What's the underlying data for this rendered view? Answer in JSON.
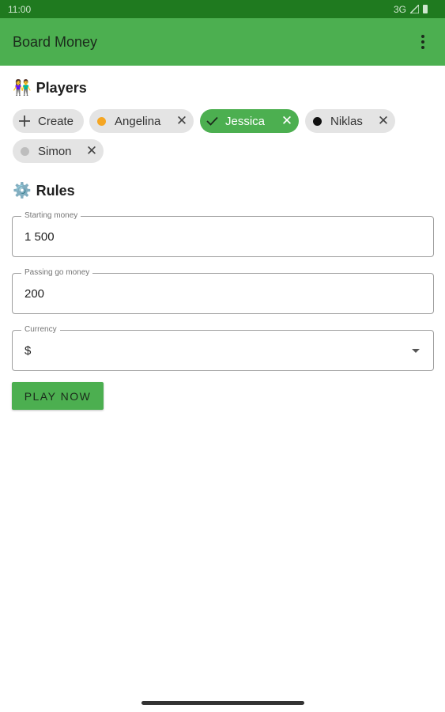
{
  "status_bar": {
    "time": "11:00",
    "network": "3G"
  },
  "app_bar": {
    "title": "Board Money",
    "menu_icon": "overflow-menu-icon"
  },
  "players_section": {
    "emoji": "👫",
    "title": "Players",
    "chips": [
      {
        "label": "Create",
        "type": "create",
        "icon": "plus-icon"
      },
      {
        "label": "Angelina",
        "type": "player",
        "color": "#f5a623",
        "selected": false
      },
      {
        "label": "Jessica",
        "type": "player",
        "selected": true
      },
      {
        "label": "Niklas",
        "type": "player",
        "color": "#111111",
        "selected": false
      },
      {
        "label": "Simon",
        "type": "player",
        "color": "#bdbdbd",
        "selected": false
      }
    ]
  },
  "rules_section": {
    "emoji": "⚙️",
    "title": "Rules",
    "starting_money": {
      "label": "Starting money",
      "value": "1 500"
    },
    "passing_go_money": {
      "label": "Passing go money",
      "value": "200"
    },
    "currency": {
      "label": "Currency",
      "value": "$"
    }
  },
  "actions": {
    "play_label": "PLAY NOW"
  },
  "colors": {
    "primary": "#4caf50",
    "status_bar": "#1f7a1f",
    "chip_bg": "#e4e4e4"
  }
}
